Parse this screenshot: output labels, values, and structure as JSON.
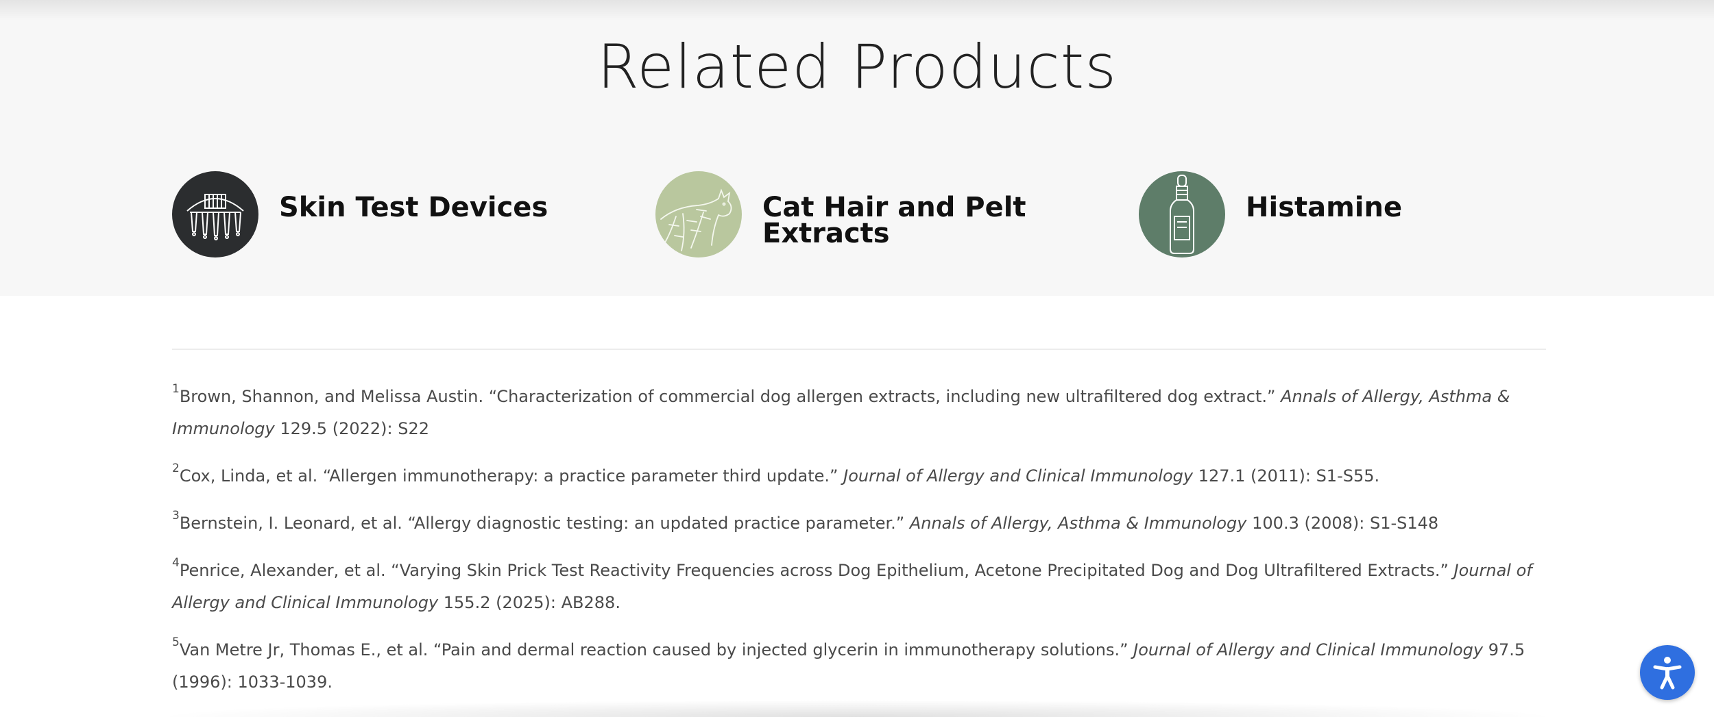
{
  "related_products": {
    "title": "Related Products",
    "items": [
      {
        "name": "Skin Test Devices",
        "icon": "skin-test-device-icon",
        "circle_color": "#2b2d2f"
      },
      {
        "name": "Cat Hair and Pelt Extracts",
        "icon": "cat-icon",
        "circle_color": "#b9c79e"
      },
      {
        "name": "Histamine",
        "icon": "dropper-bottle-icon",
        "circle_color": "#5e7d69"
      }
    ]
  },
  "references": [
    {
      "number": "1",
      "text": "Brown, Shannon, and Melissa Austin. “Characterization of commercial dog allergen extracts, including new ultrafiltered dog extract.” ",
      "journal": "Annals of Allergy, Asthma & Immunology",
      "detail": " 129.5 (2022): S22"
    },
    {
      "number": "2",
      "text": "Cox, Linda, et al. “Allergen immunotherapy: a practice parameter third update.” ",
      "journal": "Journal of Allergy and Clinical Immunology",
      "detail": " 127.1 (2011): S1-S55."
    },
    {
      "number": "3",
      "text": "Bernstein, I. Leonard, et al. “Allergy diagnostic testing: an updated practice parameter.” ",
      "journal": "Annals of Allergy, Asthma & Immunology",
      "detail": " 100.3 (2008): S1-S148"
    },
    {
      "number": "4",
      "text": "Penrice, Alexander, et al. “Varying Skin Prick Test Reactivity Frequencies across Dog Epithelium, Acetone Precipitated Dog and Dog Ultrafiltered Extracts.” ",
      "journal": "Journal of Allergy and Clinical Immunology",
      "detail": " 155.2 (2025): AB288."
    },
    {
      "number": "5",
      "text": "Van Metre Jr, Thomas E., et al. “Pain and dermal reaction caused by injected glycerin in immunotherapy solutions.” ",
      "journal": "Journal of Allergy and Clinical Immunology",
      "detail": " 97.5 (1996): 1033-1039."
    }
  ],
  "accessibility": {
    "icon": "accessibility-icon",
    "color": "#2f6fe0"
  }
}
